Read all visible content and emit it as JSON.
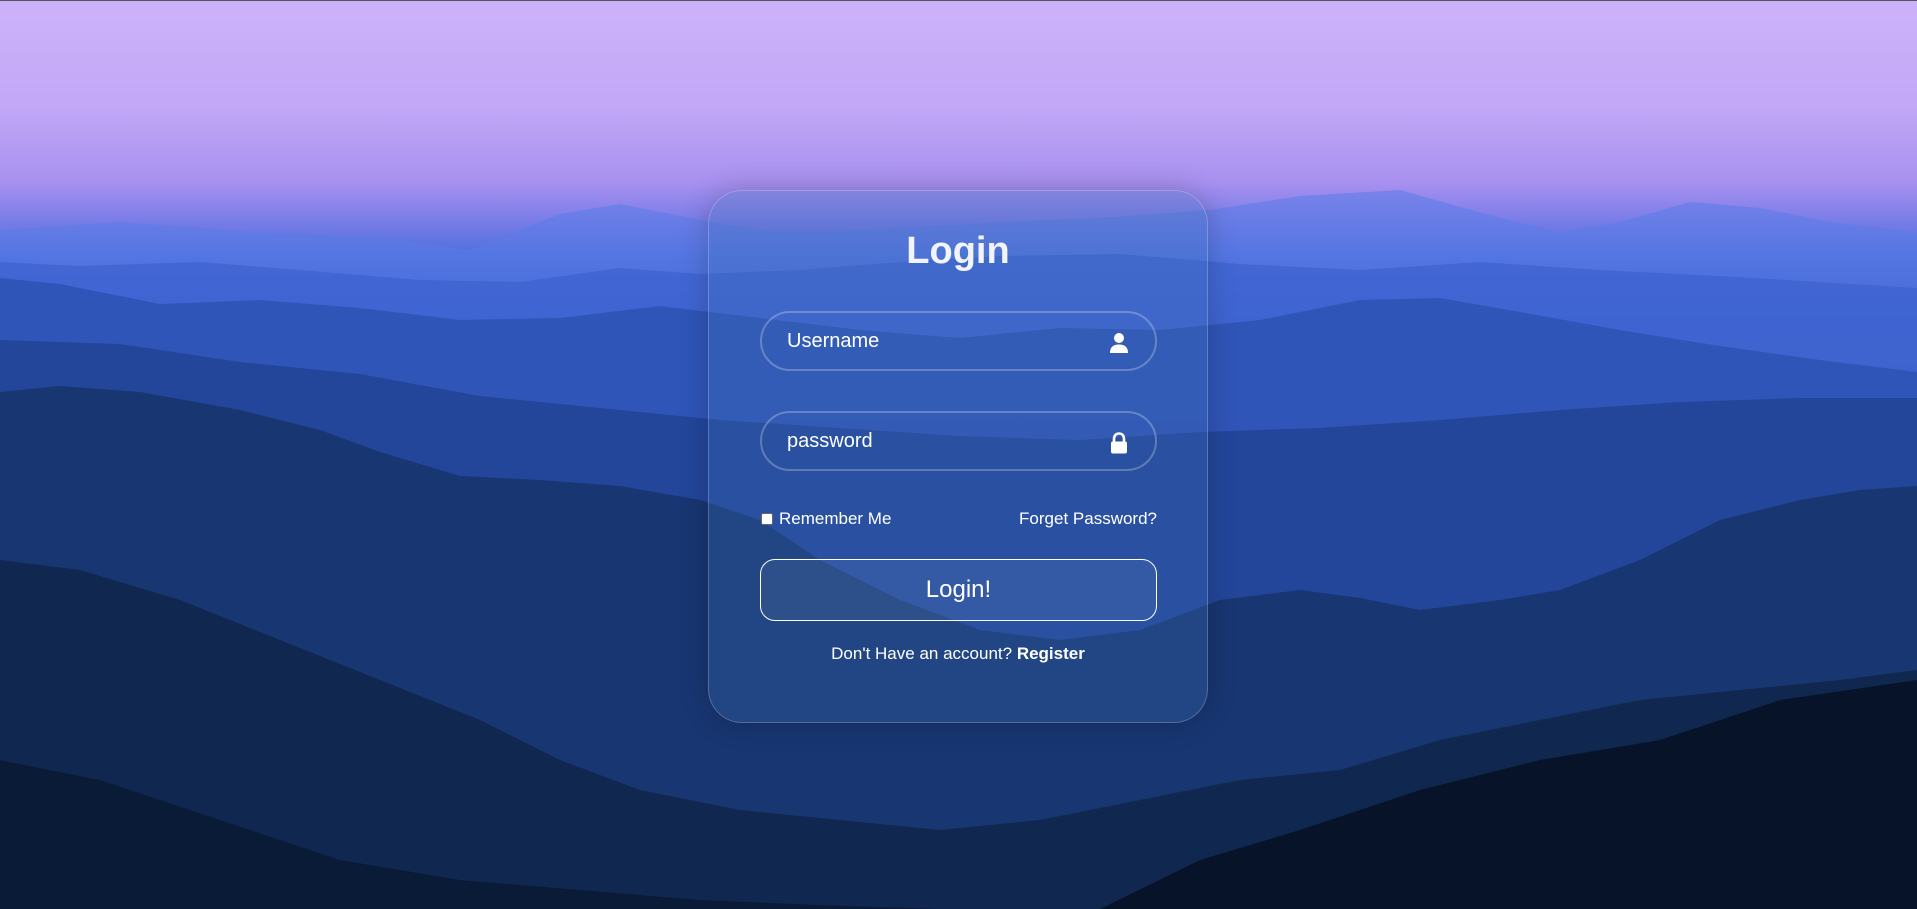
{
  "login_card": {
    "title": "Login",
    "username_placeholder": "Username",
    "username_icon": "user-icon",
    "password_placeholder": "password",
    "password_icon": "lock-icon",
    "remember_me_label": "Remember Me",
    "remember_me_checked": false,
    "forgot_password_label": "Forget Password?",
    "submit_label": "Login!",
    "register_prompt": "Don't Have an account?",
    "register_label": "Register"
  },
  "colors": {
    "sky_top": "#cdb2fb",
    "mountain_blue": "#2f58c4",
    "valley_dark": "#07142a",
    "card_tint": "rgba(60, 110, 180, 0.28)",
    "text": "#ffffff"
  }
}
